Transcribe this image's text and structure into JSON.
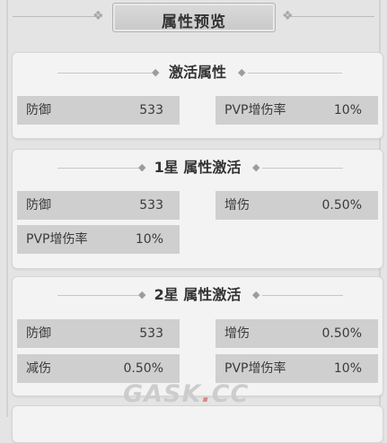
{
  "page": {
    "title": "属性预览"
  },
  "sections": [
    {
      "heading": "激活属性",
      "attributes": [
        {
          "label": "防御",
          "value": "533"
        },
        {
          "label": "PVP增伤率",
          "value": "10%"
        }
      ]
    },
    {
      "heading": "1星 属性激活",
      "attributes": [
        {
          "label": "防御",
          "value": "533"
        },
        {
          "label": "增伤",
          "value": "0.50%"
        },
        {
          "label": "PVP增伤率",
          "value": "10%"
        }
      ]
    },
    {
      "heading": "2星 属性激活",
      "attributes": [
        {
          "label": "防御",
          "value": "533"
        },
        {
          "label": "增伤",
          "value": "0.50%"
        },
        {
          "label": "减伤",
          "value": "0.50%"
        },
        {
          "label": "PVP增伤率",
          "value": "10%"
        }
      ]
    }
  ],
  "watermark": {
    "brand": "GASK",
    "dot": ".",
    "suffix": "CC"
  },
  "colors": {
    "background": "#e4e4e4",
    "card": "#f3f3f3",
    "cell": "#cfcfcf",
    "text": "#3d3d3d"
  }
}
